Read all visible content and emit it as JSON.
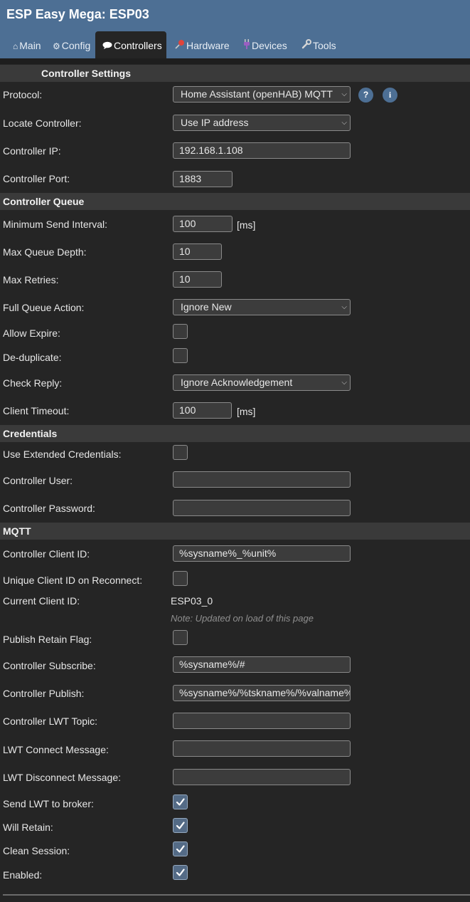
{
  "app": {
    "title": "ESP Easy Mega: ESP03"
  },
  "tabs": [
    {
      "label": "Main",
      "icon": "home-icon"
    },
    {
      "label": "Config",
      "icon": "gear-icon"
    },
    {
      "label": "Controllers",
      "icon": "speech-bubble-icon"
    },
    {
      "label": "Hardware",
      "icon": "pushpin-icon"
    },
    {
      "label": "Devices",
      "icon": "plug-icon"
    },
    {
      "label": "Tools",
      "icon": "wrench-icon"
    }
  ],
  "active_tab": "Controllers",
  "colors": {
    "header": "#4d6f94",
    "background": "#252525",
    "section": "#3a3a3a",
    "checkbox_checked": "#546b86"
  },
  "sections": {
    "controller_settings": "Controller Settings",
    "controller_queue": "Controller Queue",
    "credentials": "Credentials",
    "mqtt": "MQTT"
  },
  "fields": {
    "protocol": {
      "label": "Protocol:",
      "value": "Home Assistant (openHAB) MQTT",
      "help_button": "?",
      "info_button": "i"
    },
    "locate_controller": {
      "label": "Locate Controller:",
      "value": "Use IP address"
    },
    "controller_ip": {
      "label": "Controller IP:",
      "value": "192.168.1.108"
    },
    "controller_port": {
      "label": "Controller Port:",
      "value": "1883"
    },
    "min_send_interval": {
      "label": "Minimum Send Interval:",
      "value": "100",
      "unit": "[ms]"
    },
    "max_queue_depth": {
      "label": "Max Queue Depth:",
      "value": "10"
    },
    "max_retries": {
      "label": "Max Retries:",
      "value": "10"
    },
    "full_queue_action": {
      "label": "Full Queue Action:",
      "value": "Ignore New"
    },
    "allow_expire": {
      "label": "Allow Expire:",
      "checked": false
    },
    "deduplicate": {
      "label": "De-duplicate:",
      "checked": false
    },
    "check_reply": {
      "label": "Check Reply:",
      "value": "Ignore Acknowledgement"
    },
    "client_timeout": {
      "label": "Client Timeout:",
      "value": "100",
      "unit": "[ms]"
    },
    "use_extended_credentials": {
      "label": "Use Extended Credentials:",
      "checked": false
    },
    "controller_user": {
      "label": "Controller User:",
      "value": ""
    },
    "controller_password": {
      "label": "Controller Password:",
      "value": ""
    },
    "client_id": {
      "label": "Controller Client ID:",
      "value": "%sysname%_%unit%"
    },
    "unique_client_id": {
      "label": "Unique Client ID on Reconnect:",
      "checked": false
    },
    "current_client_id": {
      "label": "Current Client ID:",
      "value": "ESP03_0",
      "note": "Note: Updated on load of this page"
    },
    "publish_retain": {
      "label": "Publish Retain Flag:",
      "checked": false
    },
    "subscribe": {
      "label": "Controller Subscribe:",
      "value": "%sysname%/#"
    },
    "publish": {
      "label": "Controller Publish:",
      "value": "%sysname%/%tskname%/%valname%"
    },
    "lwt_topic": {
      "label": "Controller LWT Topic:",
      "value": ""
    },
    "lwt_connect": {
      "label": "LWT Connect Message:",
      "value": ""
    },
    "lwt_disconnect": {
      "label": "LWT Disconnect Message:",
      "value": ""
    },
    "send_lwt": {
      "label": "Send LWT to broker:",
      "checked": true
    },
    "will_retain": {
      "label": "Will Retain:",
      "checked": true
    },
    "clean_session": {
      "label": "Clean Session:",
      "checked": true
    },
    "enabled": {
      "label": "Enabled:",
      "checked": true
    }
  }
}
